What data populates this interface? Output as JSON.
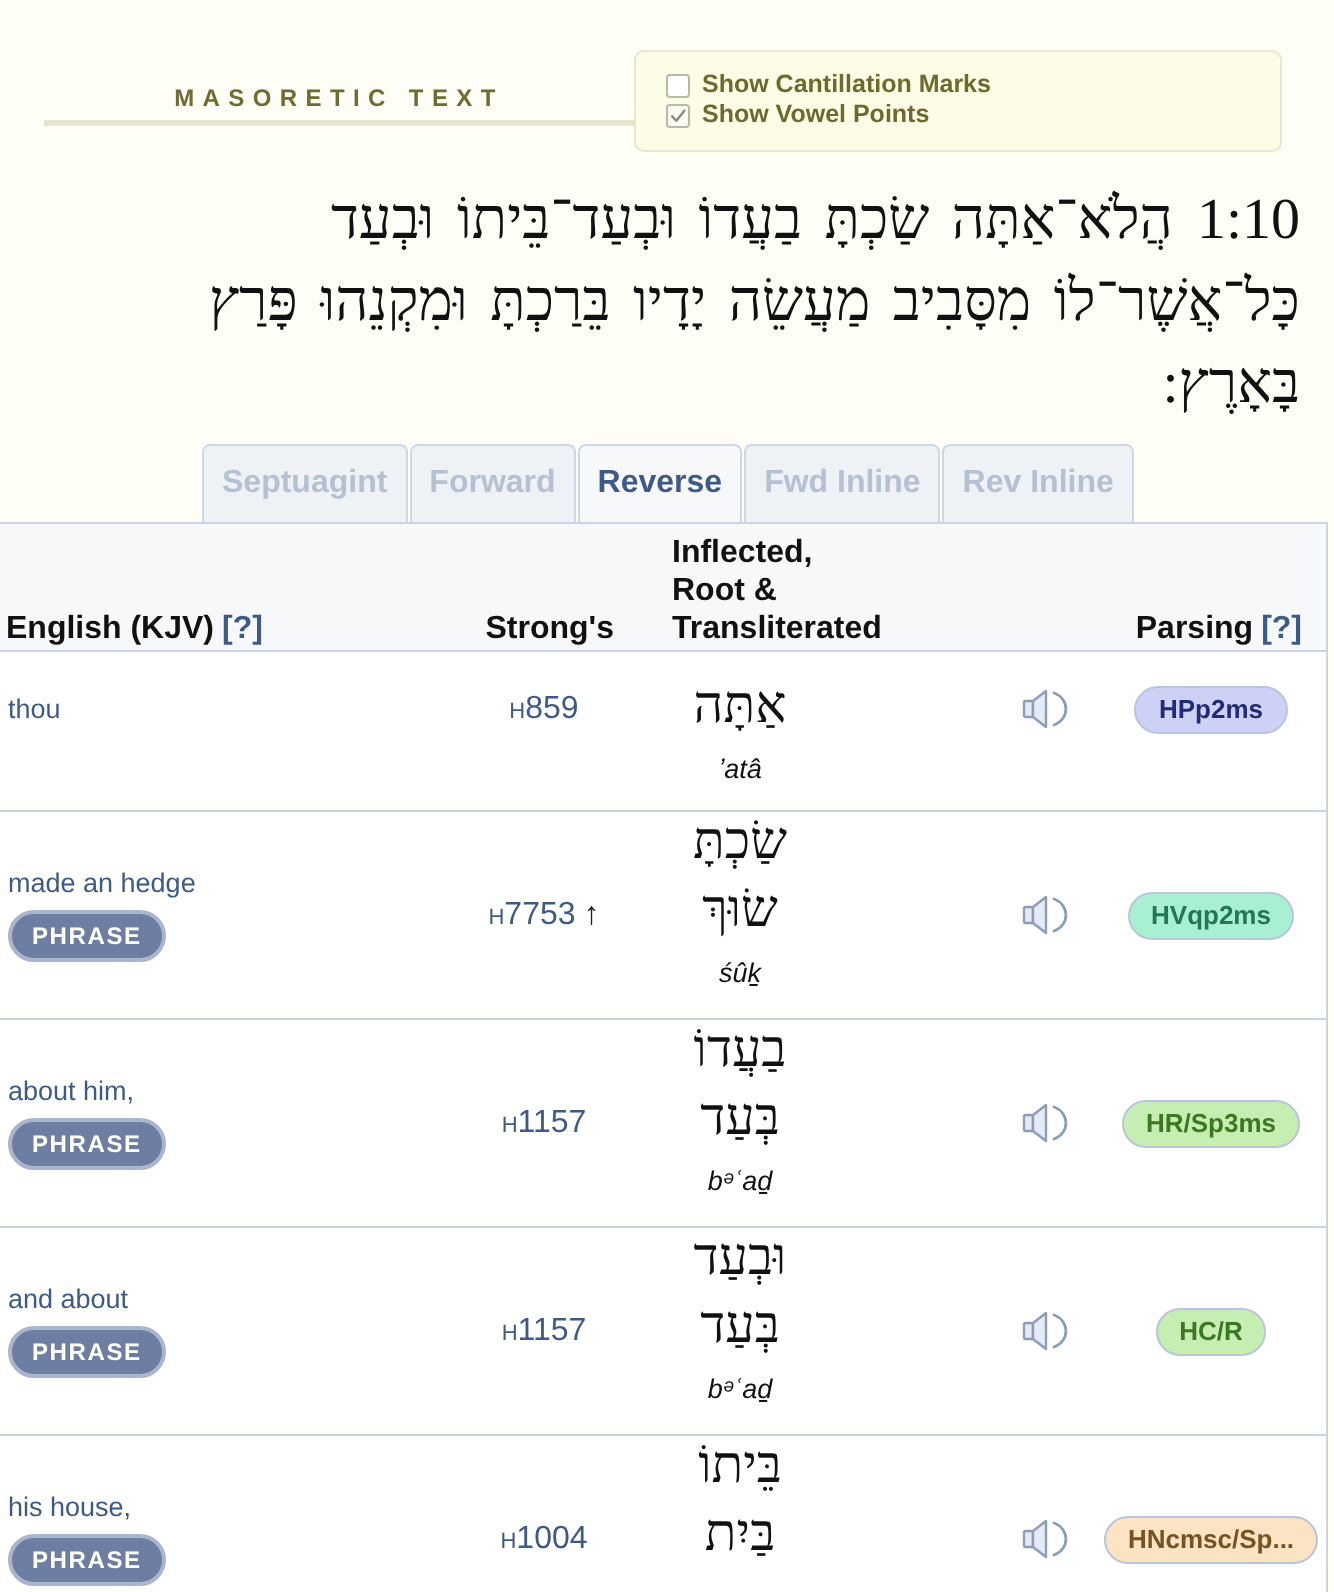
{
  "header": {
    "title": "MASORETIC TEXT"
  },
  "options": [
    {
      "label": "Show Cantillation Marks",
      "checked": false
    },
    {
      "label": "Show Vowel Points",
      "checked": true
    }
  ],
  "verse": {
    "reference": "1:10",
    "text": "הֲלֹא־אַתָּה שַׂכְתָּ בַעֲדוֹ וּבְעַד־בֵּיתוֹ וּבְעַד כָּל־אֲשֶׁר־לוֹ מִסָּבִיב מַעֲשֵׂה יָדָיו בֵּרַכְתָּ וּמִקְנֵהוּ פָּרַץ בָּאָרֶץ:"
  },
  "tabs": [
    {
      "label": "Septuagint",
      "selected": false
    },
    {
      "label": "Forward",
      "selected": false
    },
    {
      "label": "Reverse",
      "selected": true
    },
    {
      "label": "Fwd Inline",
      "selected": false
    },
    {
      "label": "Rev Inline",
      "selected": false
    }
  ],
  "table": {
    "columns": [
      {
        "label": "English (KJV)",
        "help": "[?]"
      },
      {
        "label": "Strong's"
      },
      {
        "label": "Inflected, Root & Transliterated"
      },
      {
        "label": "Parsing",
        "help": "[?]"
      }
    ],
    "rows": [
      {
        "english": "thou",
        "strongs_prefix": "H",
        "strongs_number": "859",
        "root": "אַתָּה",
        "transliteration": "ʼatâ",
        "parsing": "HPp2ms",
        "color": "#cdd1f6"
      },
      {
        "english": "made an hedge",
        "phrase": "PHRASE",
        "strongs_prefix": "H",
        "strongs_number": "7753",
        "marker": "↑",
        "inflected": "שַׂכְתָּ",
        "root": "שׂוּךְ",
        "transliteration": "śûḵ",
        "parsing": "HVqp2ms",
        "color": "#a9f0d3"
      },
      {
        "english": "about him,",
        "phrase": "PHRASE",
        "strongs_prefix": "H",
        "strongs_number": "1157",
        "inflected": "בַעֲדוֹ",
        "root": "בְּעַד",
        "transliteration": "bᵊʿaḏ",
        "parsing": "HR/Sp3ms",
        "color": "#c6eeb3"
      },
      {
        "english": "and about",
        "phrase": "PHRASE",
        "strongs_prefix": "H",
        "strongs_number": "1157",
        "inflected": "וּבְעַד",
        "root": "בְּעַד",
        "transliteration": "bᵊʿaḏ",
        "parsing": "HC/R",
        "color": "#c6eeb3"
      },
      {
        "english": "his house,",
        "phrase": "PHRASE",
        "strongs_prefix": "H",
        "strongs_number": "1004",
        "inflected": "בֵּיתוֹ",
        "root": "בַּיִת",
        "parsing": "HNcmsc/Sp...",
        "color": "#fbe3c3"
      }
    ]
  }
}
